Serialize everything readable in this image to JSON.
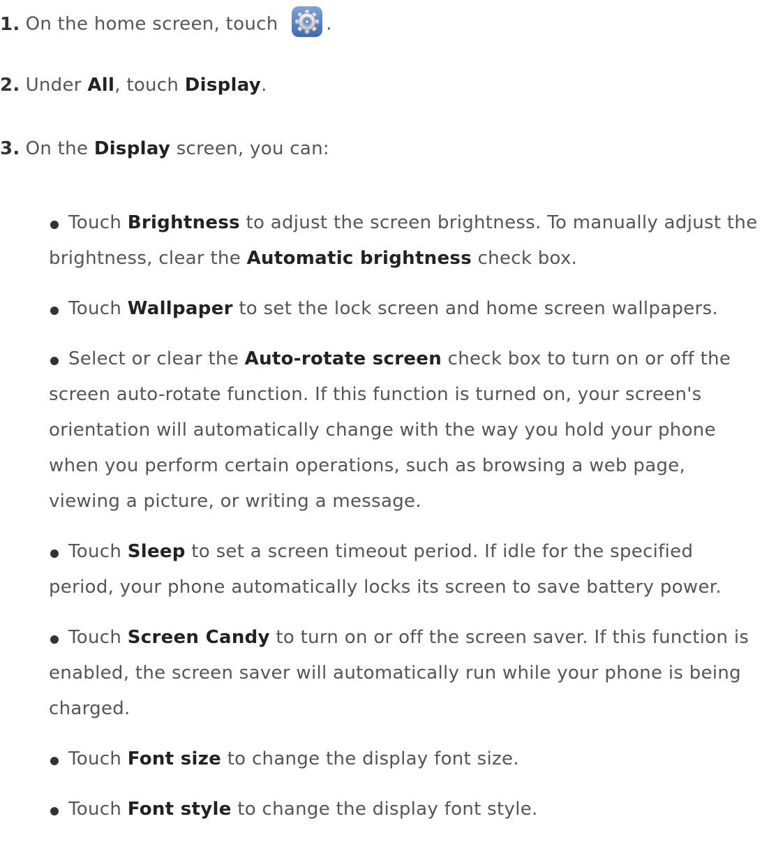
{
  "steps": [
    {
      "number": "1.",
      "text_before": "On the home screen, touch",
      "icon": "settings-gear-icon",
      "text_after": "."
    },
    {
      "number": "2.",
      "parts": [
        "Under ",
        "All",
        ", touch ",
        "Display",
        "."
      ]
    },
    {
      "number": "3.",
      "parts": [
        "On the ",
        "Display",
        " screen, you can:"
      ]
    }
  ],
  "bullets": [
    {
      "parts": [
        "Touch ",
        "Brightness",
        " to adjust the screen brightness. To manually adjust the brightness, clear the ",
        "Automatic brightness",
        " check box."
      ]
    },
    {
      "parts": [
        "Touch ",
        "Wallpaper",
        " to set the lock screen and home screen wallpapers."
      ]
    },
    {
      "parts": [
        "Select or clear the ",
        "Auto-rotate screen",
        " check box to turn on or off the screen auto-rotate function. If this function is turned on, your screen's orientation will automatically change with the way you hold your phone when you perform certain operations, such as browsing a web page, viewing a picture, or writing a message."
      ]
    },
    {
      "parts": [
        "Touch ",
        "Sleep",
        " to set a screen timeout period. If idle for the specified period, your phone automatically locks its screen to save battery power."
      ]
    },
    {
      "parts": [
        "Touch ",
        "Screen Candy",
        " to turn on or off the screen saver. If this function is enabled, the screen saver will automatically run while your phone is being charged."
      ]
    },
    {
      "parts": [
        "Touch ",
        "Font size",
        " to change the display font size."
      ]
    },
    {
      "parts": [
        "Touch ",
        "Font style",
        " to change the display font style."
      ]
    }
  ]
}
